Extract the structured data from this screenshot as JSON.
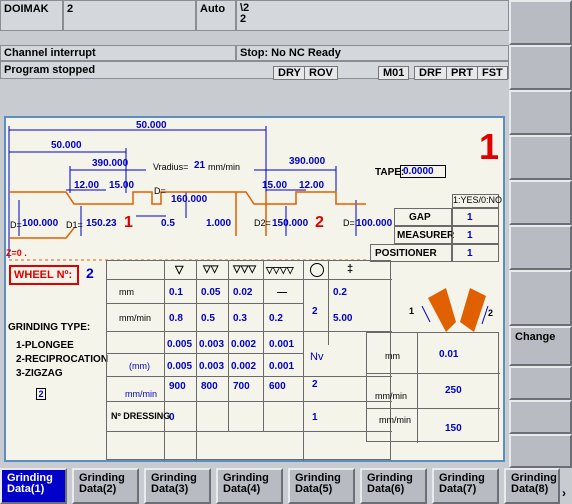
{
  "header": {
    "machine": "DOIMAK",
    "channel_num": "2",
    "mode": "Auto",
    "prog_line1": "\\2",
    "prog_line2": "2",
    "channel_state": "Channel interrupt",
    "program_state": "Program stopped",
    "alarm": "Stop: No NC Ready",
    "flags": [
      "DRY",
      "ROV",
      "M01",
      "DRF",
      "PRT",
      "FST"
    ]
  },
  "right_softkeys": [
    "",
    "",
    "",
    "",
    "",
    "",
    "Change",
    "",
    "",
    ""
  ],
  "bottom_softkeys": [
    {
      "line1": "Grinding",
      "line2": "Data(1)",
      "active": true
    },
    {
      "line1": "Grinding",
      "line2": "Data(2)",
      "active": false
    },
    {
      "line1": "Grinding",
      "line2": "Data(3)",
      "active": false
    },
    {
      "line1": "Grinding",
      "line2": "Data(4)",
      "active": false
    },
    {
      "line1": "Grinding",
      "line2": "Data(5)",
      "active": false
    },
    {
      "line1": "Grinding",
      "line2": "Data(6)",
      "active": false
    },
    {
      "line1": "Grinding",
      "line2": "Data(7)",
      "active": false
    },
    {
      "line1": "Grinding",
      "line2": "Data(8)",
      "active": false
    }
  ],
  "scroll_arrow": "›",
  "diagram": {
    "dim_top": "50.000",
    "dim_second": "50.000",
    "dim_left": "390.000",
    "vradius_label": "Vradius=",
    "vradius_value": "21",
    "vradius_unit": "mm/min",
    "dim_right": "390.000",
    "big_number": "1",
    "tape_label": "TAPE:",
    "tape_value": "0.0000",
    "w_left_a": "12.00",
    "w_left_b": "15.00",
    "w_right_a": "15.00",
    "w_right_b": "12.00",
    "d_label": "D=",
    "d_value": "160.000",
    "d_left_label": "D=",
    "d_left_value": "100.000",
    "d1_label": "D1=",
    "d1_value": "150.23",
    "mark_1": "1",
    "mid_left": "0.5",
    "mid_center": "1.000",
    "d2_label": "D2=",
    "d2_value": "150.000",
    "mark_2": "2",
    "d_right_label": "D=",
    "d_right_value": "100.000",
    "z_label": "Z=0 ."
  },
  "options": {
    "header": "1:YES/0:NO",
    "rows": [
      {
        "label": "GAP",
        "value": "1"
      },
      {
        "label": "MEASURER",
        "value": "1"
      },
      {
        "label": "POSITIONER",
        "value": "1"
      }
    ]
  },
  "wheel": {
    "label": "WHEEL Nº:",
    "value": "2"
  },
  "grinding_type": {
    "title": "GRINDING TYPE:",
    "items": [
      "1-PLONGEE",
      "2-RECIPROCATION",
      "3-ZIGZAG"
    ],
    "selected": "2"
  },
  "table": {
    "headers": [
      "▽",
      "▽▽",
      "▽▽▽",
      "▽▽▽▽"
    ],
    "row_mm": {
      "unit": "mm",
      "values": [
        "0.1",
        "0.05",
        "0.02",
        "—"
      ],
      "time": "2",
      "last": "0.2"
    },
    "row_mmmin": {
      "unit": "mm/min",
      "values": [
        "0.8",
        "0.5",
        "0.3",
        "0.2"
      ],
      "last": "5.00"
    },
    "row_a": {
      "values": [
        "0.005",
        "0.003",
        "0.002",
        "0.001"
      ]
    },
    "row_b": {
      "unit": "(mm)",
      "values": [
        "0.005",
        "0.003",
        "0.002",
        "0.001"
      ],
      "nv_label": "Nv",
      "nv_value": "2"
    },
    "row_c": {
      "unit": "mm/min",
      "values": [
        "900",
        "800",
        "700",
        "600"
      ]
    },
    "row_dressing": {
      "label": "Nº DRESSING",
      "value": "0",
      "last": "1"
    }
  },
  "right_table": {
    "r1": {
      "unit": "mm",
      "value": "0.01"
    },
    "r2": {
      "unit": "mm/min",
      "value": "250"
    },
    "r3": {
      "unit": "mm/min",
      "value": "150"
    }
  },
  "colors": {
    "accent": "#0000c8",
    "marker": "#e00000",
    "profile": "#e06000"
  }
}
